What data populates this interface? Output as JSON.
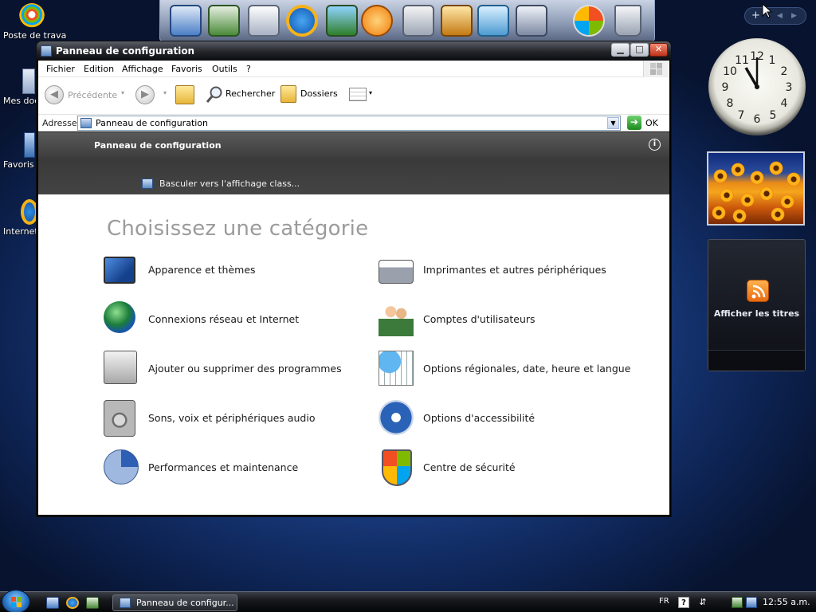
{
  "desktop": {
    "icons": [
      {
        "label": "Poste de travail",
        "icon": "my-computer-icon"
      },
      {
        "label": "Mes doc",
        "icon": "my-documents-icon"
      },
      {
        "label": "Favoris",
        "icon": "favorites-icon"
      },
      {
        "label": "Internet",
        "icon": "internet-explorer-icon"
      }
    ]
  },
  "dock": {
    "items": [
      "network-computer-icon",
      "network-places-icon",
      "notepad-icon",
      "internet-explorer-icon",
      "image-viewer-icon",
      "media-player-icon",
      "calculator-icon",
      "paint-icon",
      "notes-icon",
      "system-disk-icon",
      "windows-logo-icon",
      "recycle-bin-icon"
    ]
  },
  "sidebar": {
    "plus": "+",
    "clock": {
      "time_shown": "11:55"
    },
    "feed": {
      "label": "Afficher les titres"
    }
  },
  "window": {
    "title": "Panneau de configuration",
    "menu": [
      "Fichier",
      "Edition",
      "Affichage",
      "Favoris",
      "Outils",
      "?"
    ],
    "toolbar": {
      "back_label": "Précédente",
      "search_label": "Rechercher",
      "folders_label": "Dossiers"
    },
    "address": {
      "label": "Adresse",
      "value": "Panneau de configuration",
      "go_label": "OK"
    },
    "header": {
      "title": "Panneau de configuration",
      "switch_label": "Basculer vers l'affichage class..."
    },
    "content": {
      "heading": "Choisissez une catégorie",
      "categories": [
        {
          "label": "Apparence et thèmes",
          "icon": "appearance-themes-icon"
        },
        {
          "label": "Imprimantes et autres périphériques",
          "icon": "printers-icon"
        },
        {
          "label": "Connexions réseau et Internet",
          "icon": "network-connections-icon"
        },
        {
          "label": "Comptes d'utilisateurs",
          "icon": "user-accounts-icon"
        },
        {
          "label": "Ajouter ou supprimer des programmes",
          "icon": "add-remove-programs-icon"
        },
        {
          "label": "Options régionales, date, heure et langue",
          "icon": "regional-options-icon"
        },
        {
          "label": "Sons, voix et périphériques audio",
          "icon": "sounds-audio-icon"
        },
        {
          "label": "Options d'accessibilité",
          "icon": "accessibility-icon"
        },
        {
          "label": "Performances et maintenance",
          "icon": "performance-maintenance-icon"
        },
        {
          "label": "Centre de sécurité",
          "icon": "security-center-icon"
        }
      ]
    }
  },
  "taskbar": {
    "task_label": "Panneau de configur...",
    "language": "FR",
    "time": "12:55 a.m."
  }
}
